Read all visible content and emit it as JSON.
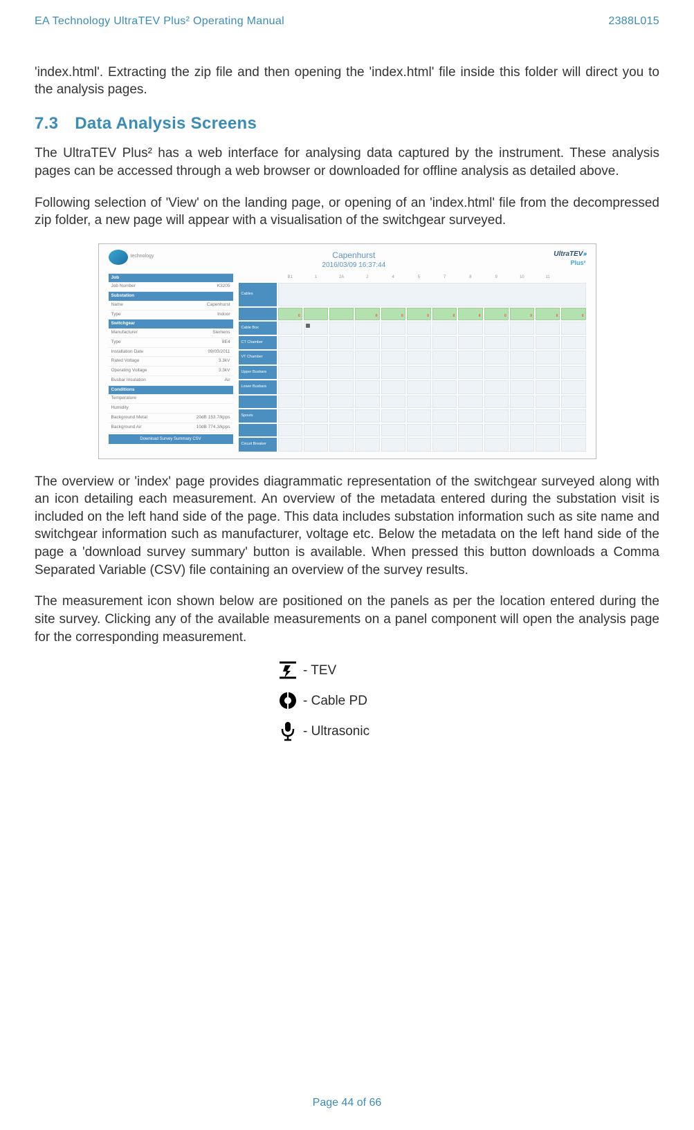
{
  "header": {
    "left": "EA Technology UltraTEV Plus² Operating Manual",
    "right": "2388L015"
  },
  "intro_para": "'index.html'. Extracting the zip file and then opening the 'index.html' file inside this folder will direct you to the analysis pages.",
  "section": {
    "num": "7.3",
    "title": "Data Analysis Screens"
  },
  "para_1": "The UltraTEV Plus² has a web interface for analysing data captured by the instrument. These analysis pages can be accessed through a web browser or downloaded for offline analysis as detailed above.",
  "para_2": "Following selection of 'View' on the landing page, or opening of an 'index.html' file from the decompressed zip folder, a new page will appear with a visualisation of the switchgear surveyed.",
  "para_3": "The overview or 'index' page provides diagrammatic representation of the switchgear surveyed along with an icon detailing each measurement. An overview of the metadata entered during the substation visit is included on the left hand side of the page. This data includes substation information such as site name and switchgear information such as manufacturer, voltage etc. Below the metadata on the left hand side of the page a 'download survey summary' button is available. When pressed this button downloads a Comma Separated Variable (CSV) file containing an overview of the survey results.",
  "para_4": "The measurement icon shown below are positioned on the panels as per the location entered during the site survey. Clicking any of the available measurements on a panel component will open the analysis page for the corresponding measurement.",
  "icons": {
    "tev": "- TEV",
    "cablepd": "- Cable PD",
    "ultrasonic": " - Ultrasonic"
  },
  "screenshot": {
    "brand_sub": "technology",
    "title": "Capenhurst",
    "datetime": "2016/03/09 16:37:44",
    "right_brand": "UltraTEV",
    "right_brand_sub": "Plus²",
    "left_panels": {
      "job_hd": "Job",
      "job_number_k": "Job Number",
      "job_number_v": "K3205",
      "substation_hd": "Substation",
      "name_k": "Name",
      "name_v": "Capenhurst",
      "type_k": "Type",
      "type_v": "Indoor",
      "switchgear_hd": "Switchgear",
      "manuf_k": "Manufacturer",
      "manuf_v": "Siemens",
      "sg_type_k": "Type",
      "sg_type_v": "8E4",
      "inst_k": "Installation Date",
      "inst_v": "09/03/2011",
      "rated_k": "Rated Voltage",
      "rated_v": "3.3kV",
      "oper_k": "Operating Voltage",
      "oper_v": "3.3kV",
      "bus_k": "Busbar Insulation",
      "bus_v": "Air",
      "cond_hd": "Conditions",
      "temp_k": "Temperature",
      "hum_k": "Humidity",
      "bgmetal_k": "Background Metal",
      "bgmetal_v": "20dB 153.7/kpps",
      "bgair_k": "Background Air",
      "bgair_v": "10dB 774.3/kpps",
      "dl_button": "Download Survey Summary CSV"
    },
    "cols": [
      "B1",
      "1",
      "2A",
      "2",
      "4",
      "5",
      "7",
      "8",
      "9",
      "10",
      "11"
    ],
    "rows": [
      "Cables",
      "",
      "Cable Box",
      "CT Chamber",
      "VT Chamber",
      "Upper Busbars",
      "Lower Busbars",
      "",
      "Spouts",
      "",
      "Circuit Breaker"
    ]
  },
  "footer": "Page 44 of 66"
}
